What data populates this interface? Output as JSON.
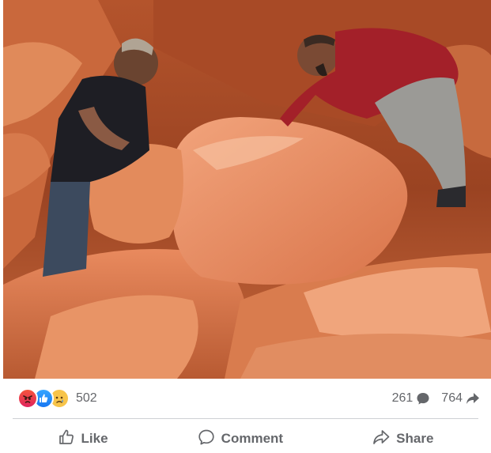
{
  "post": {
    "media": {
      "description_icon": "video-frame"
    },
    "stats": {
      "reactions": [
        "angry",
        "like",
        "sad"
      ],
      "reaction_count": "502",
      "comment_count": "261",
      "share_count": "764"
    },
    "actions": {
      "like_label": "Like",
      "comment_label": "Comment",
      "share_label": "Share"
    },
    "colors": {
      "text_secondary": "#65676b",
      "divider": "#ced0d4",
      "like_blue": "#1877f2",
      "angry_red": "#e0245e",
      "sad_yellow": "#f7c44a"
    }
  }
}
